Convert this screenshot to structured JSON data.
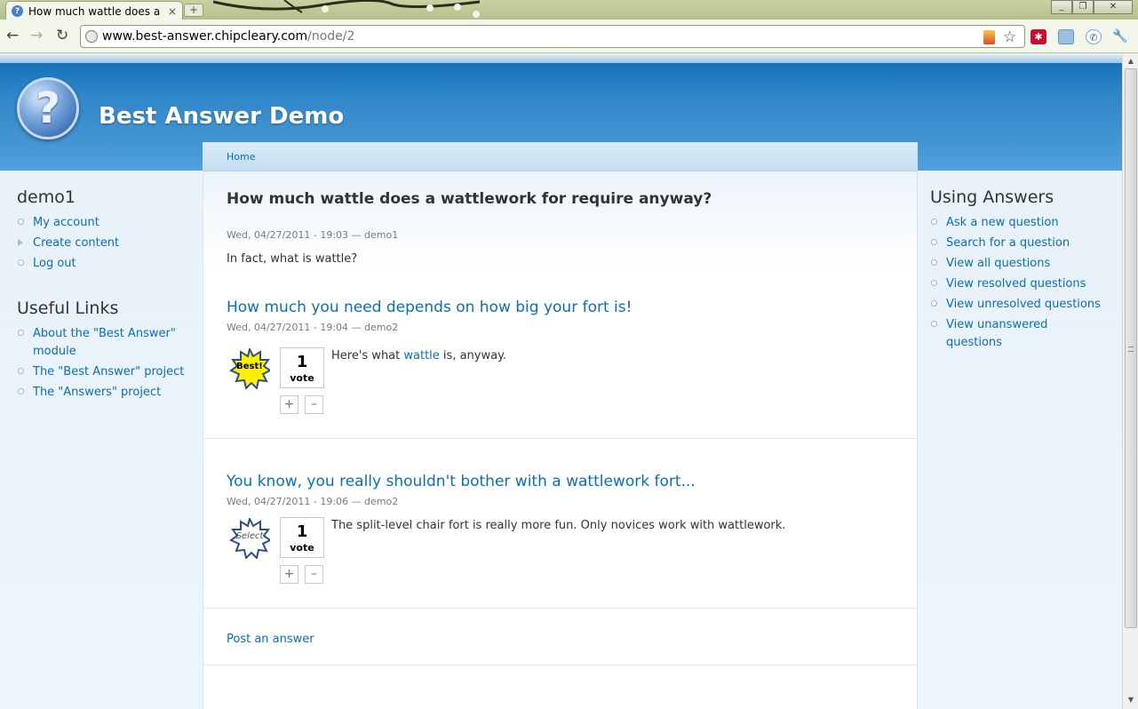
{
  "browser": {
    "tab_title": "How much wattle does a ...",
    "tab_close": "×",
    "new_tab": "+",
    "url_domain": "www.best-answer.chipcleary.com",
    "url_path": "/node/2",
    "back": "←",
    "forward": "→",
    "reload": "↻",
    "star": "☆",
    "wrench": "🔧",
    "minimize": "_",
    "maximize": "❐",
    "close": "✕"
  },
  "site": {
    "logo_glyph": "?",
    "name": "Best Answer Demo"
  },
  "sidebar_left": {
    "user_block": {
      "title": "demo1",
      "items": [
        {
          "label": "My account"
        },
        {
          "label": "Create content"
        },
        {
          "label": "Log out"
        }
      ]
    },
    "links_block": {
      "title": "Useful Links",
      "items": [
        {
          "label": "About the \"Best Answer\" module"
        },
        {
          "label": "The \"Best Answer\" project"
        },
        {
          "label": "The \"Answers\" project"
        }
      ]
    }
  },
  "sidebar_right": {
    "title": "Using Answers",
    "items": [
      {
        "label": "Ask a new question"
      },
      {
        "label": "Search for a question"
      },
      {
        "label": "View all questions"
      },
      {
        "label": "View resolved questions"
      },
      {
        "label": "View unresolved questions"
      },
      {
        "label": "View unanswered questions"
      }
    ]
  },
  "main": {
    "breadcrumb": "Home",
    "question": {
      "title": "How much wattle does a wattlework for require anyway?",
      "meta": "Wed, 04/27/2011 - 19:03 — demo1",
      "body": "In fact, what is wattle?"
    },
    "answers": [
      {
        "title": "How much you need depends on how big your fort is!",
        "meta": "Wed, 04/27/2011 - 19:04 — demo2",
        "badge": "Best!",
        "badge_state": "best",
        "vote_count": "1",
        "vote_label": "vote",
        "upvote": "+",
        "downvote": "–",
        "body_before": "Here's what ",
        "body_link": "wattle",
        "body_after": " is, anyway."
      },
      {
        "title": "You know, you really shouldn't bother with a wattlework fort...",
        "meta": "Wed, 04/27/2011 - 19:06 — demo2",
        "badge": "Select",
        "badge_state": "select",
        "vote_count": "1",
        "vote_label": "vote",
        "upvote": "+",
        "downvote": "–",
        "body_before": "The split-level chair fort is really more fun. Only novices work with wattlework.",
        "body_link": "",
        "body_after": ""
      }
    ],
    "post_answer": "Post an answer"
  },
  "colors": {
    "link": "#0a6fb3",
    "header_blue": "#2f86c8",
    "best_badge": "#ffef00",
    "badge_outline": "#2f4f86"
  }
}
